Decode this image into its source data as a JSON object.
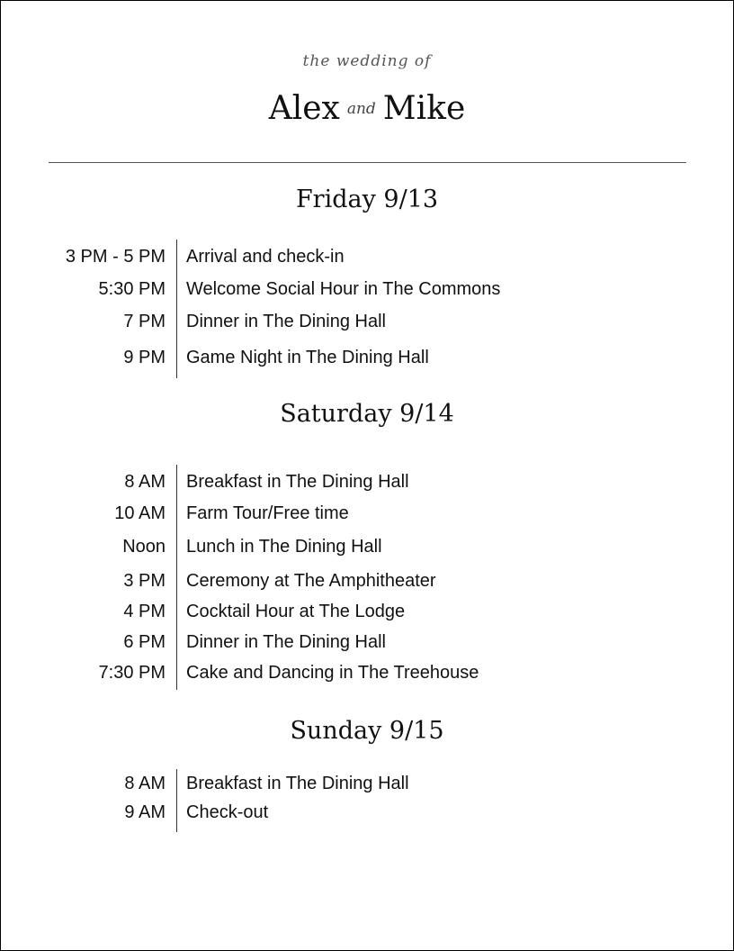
{
  "header": {
    "subtitle": "the wedding of",
    "name1": "Alex",
    "and": "and",
    "name2": "Mike"
  },
  "days": [
    {
      "title": "Friday 9/13",
      "events": [
        {
          "time": "3 PM - 5 PM",
          "event": "Arrival and check-in"
        },
        {
          "time": "5:30 PM",
          "event": "Welcome Social Hour in The Commons"
        },
        {
          "time": "7 PM",
          "event": "Dinner in The Dining Hall"
        },
        {
          "time": "9 PM",
          "event": "Game Night in The Dining Hall"
        }
      ]
    },
    {
      "title": "Saturday 9/14",
      "events": [
        {
          "time": "8 AM",
          "event": "Breakfast in The Dining Hall"
        },
        {
          "time": "10 AM",
          "event": "Farm Tour/Free time"
        },
        {
          "time": "Noon",
          "event": "Lunch in The Dining Hall"
        },
        {
          "time": "3 PM",
          "event": "Ceremony at The Amphitheater"
        },
        {
          "time": "4 PM",
          "event": "Cocktail Hour at The Lodge"
        },
        {
          "time": "6 PM",
          "event": "Dinner in The Dining Hall"
        },
        {
          "time": "7:30 PM",
          "event": "Cake and Dancing in The Treehouse"
        }
      ]
    },
    {
      "title": "Sunday 9/15",
      "events": [
        {
          "time": "8 AM",
          "event": "Breakfast in The Dining Hall"
        },
        {
          "time": "9 AM",
          "event": "Check-out"
        }
      ]
    }
  ]
}
